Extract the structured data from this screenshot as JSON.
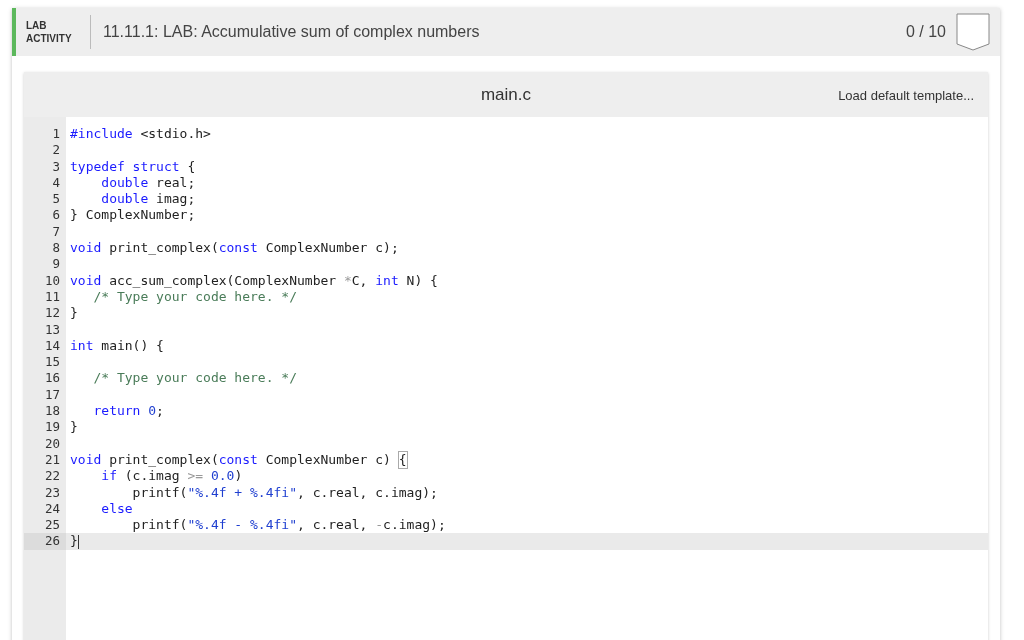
{
  "header": {
    "tag_lines": [
      "LAB",
      "ACTIVITY"
    ],
    "title": "11.11.1: LAB: Accumulative sum of complex numbers",
    "score": "0 / 10"
  },
  "editor": {
    "filename": "main.c",
    "action": "Load default template...",
    "lines": [
      {
        "number": "1",
        "active": false,
        "tokens": [
          {
            "kind": "kw",
            "text": "#include"
          },
          {
            "kind": "plain",
            "text": " <stdio.h>"
          }
        ]
      },
      {
        "number": "2",
        "active": false
      },
      {
        "number": "3",
        "active": false,
        "tokens": [
          {
            "kind": "kw",
            "text": "typedef struct"
          },
          {
            "kind": "plain",
            "text": " {"
          }
        ]
      },
      {
        "number": "4",
        "active": false,
        "tokens": [
          {
            "kind": "kw",
            "text": "    double"
          },
          {
            "kind": "plain",
            "text": " real;"
          }
        ]
      },
      {
        "number": "5",
        "active": false,
        "tokens": [
          {
            "kind": "kw",
            "text": "    double"
          },
          {
            "kind": "plain",
            "text": " imag;"
          }
        ]
      },
      {
        "number": "6",
        "active": false,
        "tokens": [
          {
            "kind": "plain",
            "text": "} ComplexNumber;"
          }
        ]
      },
      {
        "number": "7",
        "active": false
      },
      {
        "number": "8",
        "active": false,
        "tokens": [
          {
            "kind": "kw",
            "text": "void"
          },
          {
            "kind": "plain",
            "text": " print_complex("
          },
          {
            "kind": "kw",
            "text": "const"
          },
          {
            "kind": "plain",
            "text": " ComplexNumber c);"
          }
        ]
      },
      {
        "number": "9",
        "active": false
      },
      {
        "number": "10",
        "active": false,
        "tokens": [
          {
            "kind": "kw",
            "text": "void"
          },
          {
            "kind": "plain",
            "text": " acc_sum_complex(ComplexNumber "
          },
          {
            "kind": "op",
            "text": "*"
          },
          {
            "kind": "plain",
            "text": "C, "
          },
          {
            "kind": "kw",
            "text": "int"
          },
          {
            "kind": "plain",
            "text": " N) {"
          }
        ]
      },
      {
        "number": "11",
        "active": false,
        "tokens": [
          {
            "kind": "comment",
            "text": "   /* Type your code here. */"
          }
        ]
      },
      {
        "number": "12",
        "active": false,
        "tokens": [
          {
            "kind": "plain",
            "text": "}"
          }
        ]
      },
      {
        "number": "13",
        "active": false
      },
      {
        "number": "14",
        "active": false,
        "tokens": [
          {
            "kind": "kw",
            "text": "int"
          },
          {
            "kind": "plain",
            "text": " main() {"
          }
        ]
      },
      {
        "number": "15",
        "active": false
      },
      {
        "number": "16",
        "active": false,
        "tokens": [
          {
            "kind": "comment",
            "text": "   /* Type your code here. */"
          }
        ]
      },
      {
        "number": "17",
        "active": false
      },
      {
        "number": "18",
        "active": false,
        "tokens": [
          {
            "kind": "kw",
            "text": "   return "
          },
          {
            "kind": "num",
            "text": "0"
          },
          {
            "kind": "plain",
            "text": ";"
          }
        ]
      },
      {
        "number": "19",
        "active": false,
        "tokens": [
          {
            "kind": "plain",
            "text": "}"
          }
        ]
      },
      {
        "number": "20",
        "active": false
      },
      {
        "number": "21",
        "active": false,
        "tokens": [
          {
            "kind": "kw",
            "text": "void"
          },
          {
            "kind": "plain",
            "text": " print_complex("
          },
          {
            "kind": "kw",
            "text": "const"
          },
          {
            "kind": "plain",
            "text": " ComplexNumber c) "
          },
          {
            "kind": "match",
            "text": "{"
          }
        ]
      },
      {
        "number": "22",
        "active": false,
        "tokens": [
          {
            "kind": "kw",
            "text": "    if"
          },
          {
            "kind": "plain",
            "text": " (c.imag "
          },
          {
            "kind": "op",
            "text": ">= "
          },
          {
            "kind": "num",
            "text": "0.0"
          },
          {
            "kind": "plain",
            "text": ")"
          }
        ]
      },
      {
        "number": "23",
        "active": false,
        "tokens": [
          {
            "kind": "plain",
            "text": "        printf("
          },
          {
            "kind": "str",
            "text": "\"%.4f + %.4fi\""
          },
          {
            "kind": "plain",
            "text": ", c.real, c.imag);"
          }
        ]
      },
      {
        "number": "24",
        "active": false,
        "tokens": [
          {
            "kind": "kw",
            "text": "    else"
          }
        ]
      },
      {
        "number": "25",
        "active": false,
        "tokens": [
          {
            "kind": "plain",
            "text": "        printf("
          },
          {
            "kind": "str",
            "text": "\"%.4f - %.4fi\""
          },
          {
            "kind": "plain",
            "text": ", c.real, "
          },
          {
            "kind": "op",
            "text": "-"
          },
          {
            "kind": "plain",
            "text": "c.imag);"
          }
        ]
      },
      {
        "number": "26",
        "active": true,
        "tokens": [
          {
            "kind": "plain",
            "text": "}"
          }
        ]
      }
    ]
  }
}
